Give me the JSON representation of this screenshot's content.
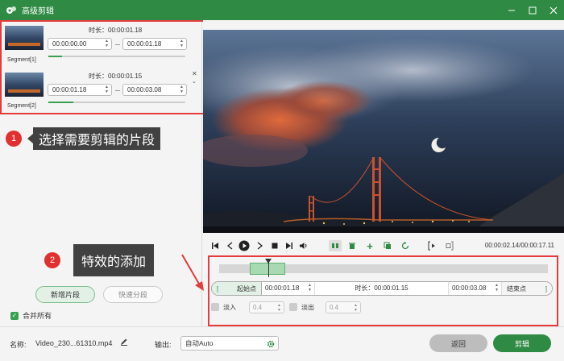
{
  "window": {
    "title": "高级剪辑",
    "controls": [
      "minimize-icon",
      "maximize-icon",
      "close-icon"
    ]
  },
  "segments": [
    {
      "label": "Segment[1]",
      "duration": "时长：00:00:01.18",
      "start": "00:00:00.00",
      "end": "00:00:01.18",
      "progress": 0.1,
      "removable": false
    },
    {
      "label": "Segment[2]",
      "duration": "时长：00:00:01.15",
      "start": "00:00:01.18",
      "end": "00:00:03.08",
      "progress": 0.18,
      "removable": true
    }
  ],
  "annotations": [
    {
      "num": "1",
      "text": "选择需要剪辑的片段"
    },
    {
      "num": "2",
      "text": "特效的添加"
    }
  ],
  "left_actions": {
    "add_segment": "新增片段",
    "quick_split": "快速分段",
    "merge_all": "合并所有",
    "merge_checked": true
  },
  "player": {
    "time": "00:00:02.14/00:00:17.11"
  },
  "trim": {
    "start_label": "起始点",
    "start_time": "00:00:01.18",
    "duration": "时长：00:00:01.15",
    "end_time": "00:00:03.08",
    "end_label": "结束点",
    "bracket_left": "[",
    "bracket_right": "]"
  },
  "fade": {
    "in_label": "淡入",
    "in_value": "0.4",
    "out_label": "淡出",
    "out_value": "0.4"
  },
  "bottom": {
    "name_label": "名称:",
    "name_value": "Video_230...61310.mp4",
    "output_label": "输出:",
    "output_value": "自动Auto",
    "back": "返回",
    "cut": "剪辑"
  },
  "colors": {
    "accent": "#2f8a44",
    "annotation_red": "#e53b3b",
    "annotation_bg": "#414141"
  }
}
